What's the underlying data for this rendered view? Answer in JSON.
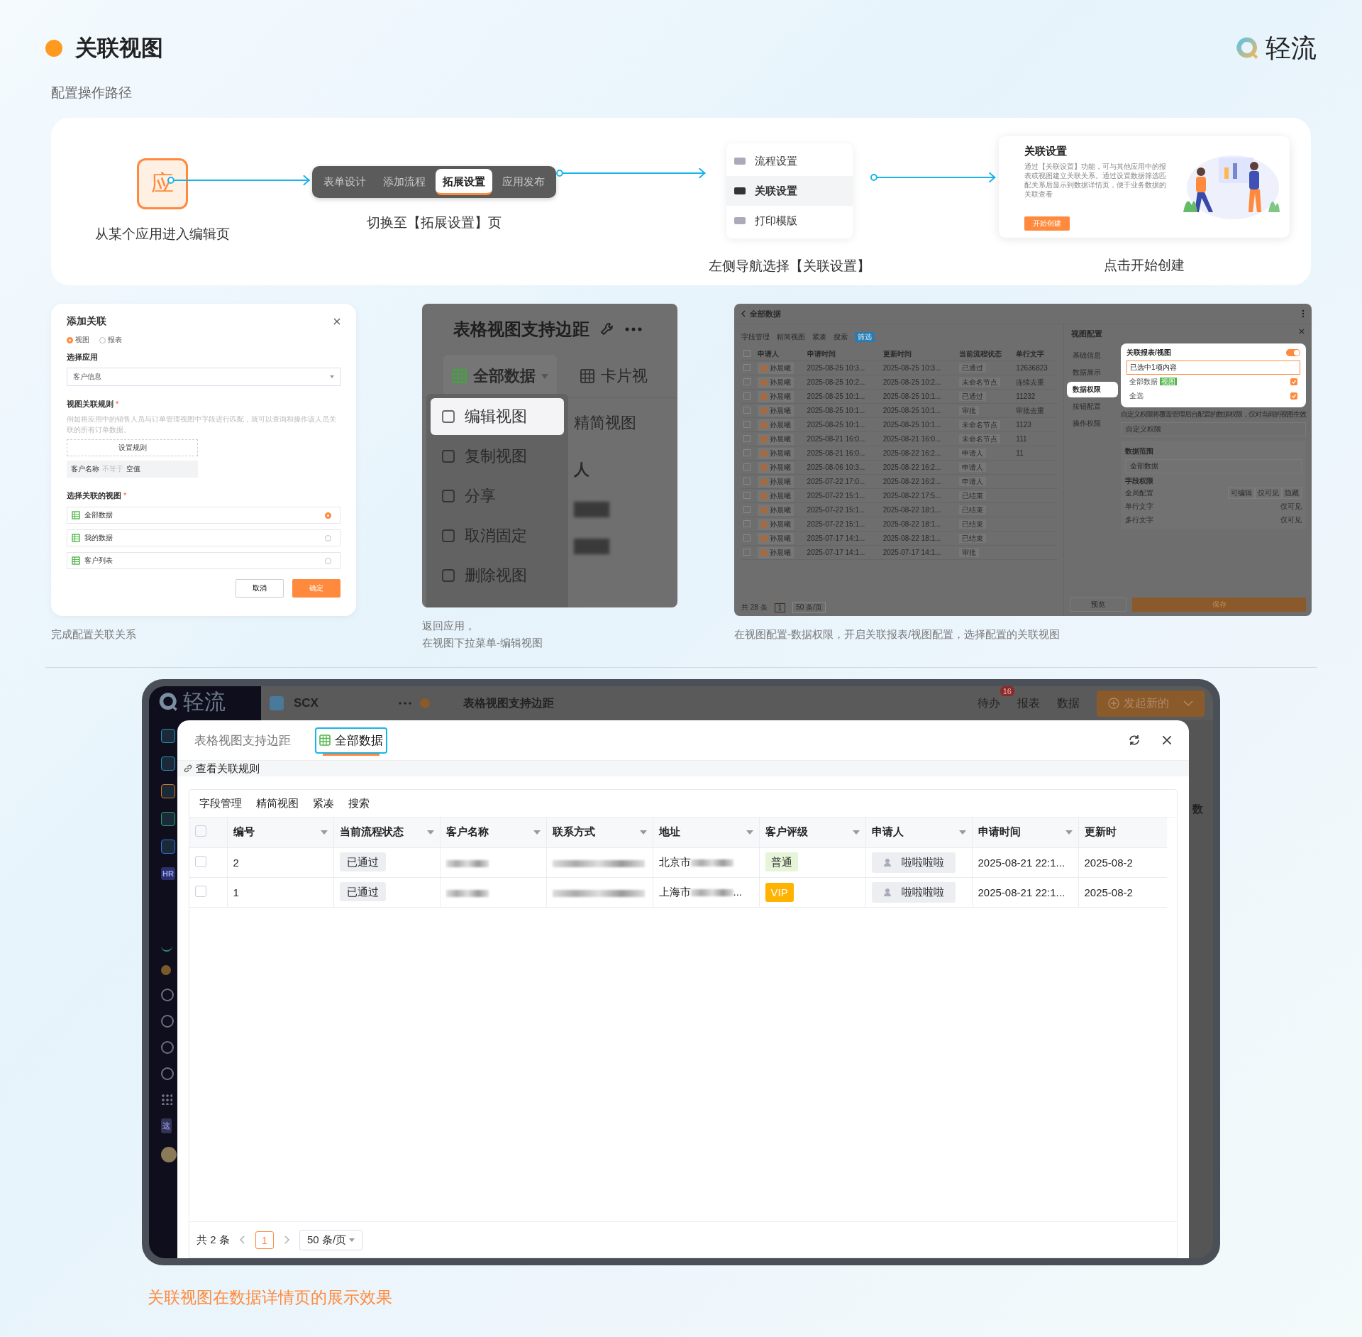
{
  "header": {
    "title": "关联视图",
    "brand": "轻流"
  },
  "subtitle": "配置操作路径",
  "flow": {
    "enter": {
      "icon": "应",
      "caption": "从某个应用进入编辑页"
    },
    "tabs": {
      "items": [
        {
          "label": "表单设计",
          "selected": false
        },
        {
          "label": "添加流程",
          "selected": false
        },
        {
          "label": "拓展设置",
          "selected": true
        },
        {
          "label": "应用发布",
          "selected": false
        }
      ],
      "caption": "切换至【拓展设置】页"
    },
    "nav": {
      "items": [
        {
          "label": "流程设置",
          "selected": false
        },
        {
          "label": "关联设置",
          "selected": true
        },
        {
          "label": "打印模版",
          "selected": false
        }
      ],
      "caption": "左侧导航选择【关联设置】"
    },
    "start": {
      "title": "关联设置",
      "description": "通过【关联设置】功能，可与其他应用中的报表或视图建立关联关系。通过设置数据筛选匹配关系后显示到数据详情页，便于业务数据的关联查看",
      "button": "开始创建",
      "caption": "点击开始创建"
    }
  },
  "add_relation": {
    "title": "添加关联",
    "types": [
      {
        "label": "视图",
        "selected": true
      },
      {
        "label": "报表",
        "selected": false
      }
    ],
    "app_label": "选择应用",
    "app_value": "客户信息",
    "rule_label": "视图关联规则",
    "required": "*",
    "rule_hint": "例如将应用中的销售人员与订单管理视图中字段进行匹配，就可以查询和操作该人员关联的所有订单数据。",
    "rule_button": "设置规则",
    "condition": {
      "field": "客户名称",
      "operator": "不等于",
      "value": "空值"
    },
    "views_label": "选择关联的视图",
    "views": [
      {
        "label": "全部数据",
        "selected": true
      },
      {
        "label": "我的数据",
        "selected": false
      },
      {
        "label": "客户列表",
        "selected": false
      }
    ],
    "cancel": "取消",
    "confirm": "确定",
    "caption": "完成配置关联关系"
  },
  "view_menu": {
    "title": "表格视图支持边距",
    "tabs": [
      {
        "label": "全部数据",
        "selected": true
      },
      {
        "label": "卡片视",
        "selected": false
      }
    ],
    "menu": [
      {
        "label": "编辑视图",
        "selected": true
      },
      {
        "label": "复制视图",
        "selected": false
      },
      {
        "label": "分享",
        "selected": false
      },
      {
        "label": "取消固定",
        "selected": false
      },
      {
        "label": "删除视图",
        "selected": false
      }
    ],
    "behind": [
      "精简视图",
      "人"
    ],
    "caption": [
      "返回应用，",
      "在视图下拉菜单-编辑视图"
    ]
  },
  "view_config": {
    "title": "全部数据",
    "toolbar": [
      "字段管理",
      "精简视图",
      "紧凑",
      "搜索",
      "筛选"
    ],
    "columns": [
      "申请人",
      "申请时间",
      "更新时间",
      "当前流程状态",
      "单行文字"
    ],
    "all_checked": false,
    "rows": [
      {
        "checked": false,
        "applicant": "孙晨曦",
        "applied": "2025-08-25 10:3...",
        "updated": "2025-08-25 10:3...",
        "status": "已通过",
        "text": "12636823"
      },
      {
        "checked": false,
        "applicant": "孙晨曦",
        "applied": "2025-08-25 10:2...",
        "updated": "2025-08-25 10:2...",
        "status": "未命名节点",
        "text": "连续去重"
      },
      {
        "checked": false,
        "applicant": "孙晨曦",
        "applied": "2025-08-25 10:1...",
        "updated": "2025-08-25 10:1...",
        "status": "已通过",
        "text": "11232"
      },
      {
        "checked": false,
        "applicant": "孙晨曦",
        "applied": "2025-08-25 10:1...",
        "updated": "2025-08-25 10:1...",
        "status": "审批",
        "text": "审批去重"
      },
      {
        "checked": false,
        "applicant": "孙晨曦",
        "applied": "2025-08-25 10:1...",
        "updated": "2025-08-25 10:1...",
        "status": "未命名节点",
        "text": "1123"
      },
      {
        "checked": false,
        "applicant": "孙晨曦",
        "applied": "2025-08-21 16:0...",
        "updated": "2025-08-21 16:0...",
        "status": "未命名节点",
        "text": "111"
      },
      {
        "checked": false,
        "applicant": "孙晨曦",
        "applied": "2025-08-21 16:0...",
        "updated": "2025-08-22 16:2...",
        "status": "申请人",
        "text": "11"
      },
      {
        "checked": false,
        "applicant": "孙晨曦",
        "applied": "2025-08-06 10:3...",
        "updated": "2025-08-22 16:2...",
        "status": "申请人"
      },
      {
        "checked": false,
        "applicant": "孙晨曦",
        "applied": "2025-07-22 17:0...",
        "updated": "2025-08-22 16:2...",
        "status": "申请人"
      },
      {
        "checked": false,
        "applicant": "孙晨曦",
        "applied": "2025-07-22 15:1...",
        "updated": "2025-08-22 17:5...",
        "status": "已结束"
      },
      {
        "checked": false,
        "applicant": "孙晨曦",
        "applied": "2025-07-22 15:1...",
        "updated": "2025-08-22 18:1...",
        "status": "已结束"
      },
      {
        "checked": false,
        "applicant": "孙晨曦",
        "applied": "2025-07-22 15:1...",
        "updated": "2025-08-22 18:1...",
        "status": "已结束"
      },
      {
        "checked": false,
        "applicant": "孙晨曦",
        "applied": "2025-07-17 14:1...",
        "updated": "2025-08-22 18:1...",
        "status": "已结束"
      },
      {
        "checked": false,
        "applicant": "孙晨曦",
        "applied": "2025-07-17 14:1...",
        "updated": "2025-07-17 14:1...",
        "status": "审批"
      }
    ],
    "footer": {
      "total": "共 28 条",
      "page": "1",
      "page_size": "50 条/页"
    },
    "panel_title": "视图配置",
    "nav": [
      {
        "label": "基础信息",
        "selected": false
      },
      {
        "label": "数据展示",
        "selected": false
      },
      {
        "label": "数据权限",
        "selected": true
      },
      {
        "label": "按钮配置",
        "selected": false
      },
      {
        "label": "操作权限",
        "selected": false
      }
    ],
    "popup": {
      "title": "关联报表/视图",
      "on": true,
      "select": "已选中1项内容",
      "options": [
        {
          "label": "全部数据",
          "tag": "视图",
          "checked": true
        },
        {
          "label": "全选",
          "checked": true
        }
      ]
    },
    "note": "自定义权限将覆盖管理后台配置的数据权限，仅对当前的视图生效",
    "permission": "自定义权限",
    "scope_label": "数据范围",
    "scope_value": "全部数据",
    "fields_label": "字段权限",
    "global": "全局配置",
    "modes": [
      "可编辑",
      "仅可见",
      "隐藏"
    ],
    "fields": [
      {
        "name": "单行文字",
        "mode": "仅可见"
      },
      {
        "name": "多行文字",
        "mode": "仅可见"
      }
    ],
    "preview": "预览",
    "save": "保存",
    "caption": "在视图配置-数据权限，开启关联报表/视图配置，选择配置的关联视图"
  },
  "detail_window": {
    "brand": "轻流",
    "app": "SCX",
    "page_title": "表格视图支持边距",
    "todo": "待办",
    "todo_badge": "16",
    "report": "报表",
    "data": "数据",
    "new_button": "发起新的",
    "sidebar_badges": [
      "HR",
      "这"
    ],
    "behind": "数",
    "tabs": [
      {
        "label": "表格视图支持边距",
        "selected": false
      },
      {
        "label": "全部数据",
        "selected": true
      }
    ],
    "all_checked": false,
    "rule_link": "查看关联规则",
    "toolbar": [
      "字段管理",
      "精简视图",
      "紧凑",
      "搜索"
    ],
    "columns": [
      "编号",
      "当前流程状态",
      "客户名称",
      "联系方式",
      "地址",
      "客户评级",
      "申请人",
      "申请时间",
      "更新时"
    ],
    "rows": [
      {
        "checked": false,
        "number": "2",
        "status": "已通过",
        "address": "北京市",
        "rating": {
          "label": "普通",
          "kind": "plain"
        },
        "applicant": "啦啦啦啦",
        "applied": "2025-08-21 22:1...",
        "updated": "2025-08-2"
      },
      {
        "checked": false,
        "number": "1",
        "status": "已通过",
        "address": "上海市",
        "address_tail": "...",
        "rating": {
          "label": "VIP",
          "kind": "vip"
        },
        "applicant": "啦啦啦啦",
        "applied": "2025-08-21 22:1...",
        "updated": "2025-08-2"
      }
    ],
    "footer": {
      "total": "共 2 条",
      "page": "1",
      "page_size": "50 条/页"
    }
  },
  "caption": "关联视图在数据详情页的展示效果"
}
